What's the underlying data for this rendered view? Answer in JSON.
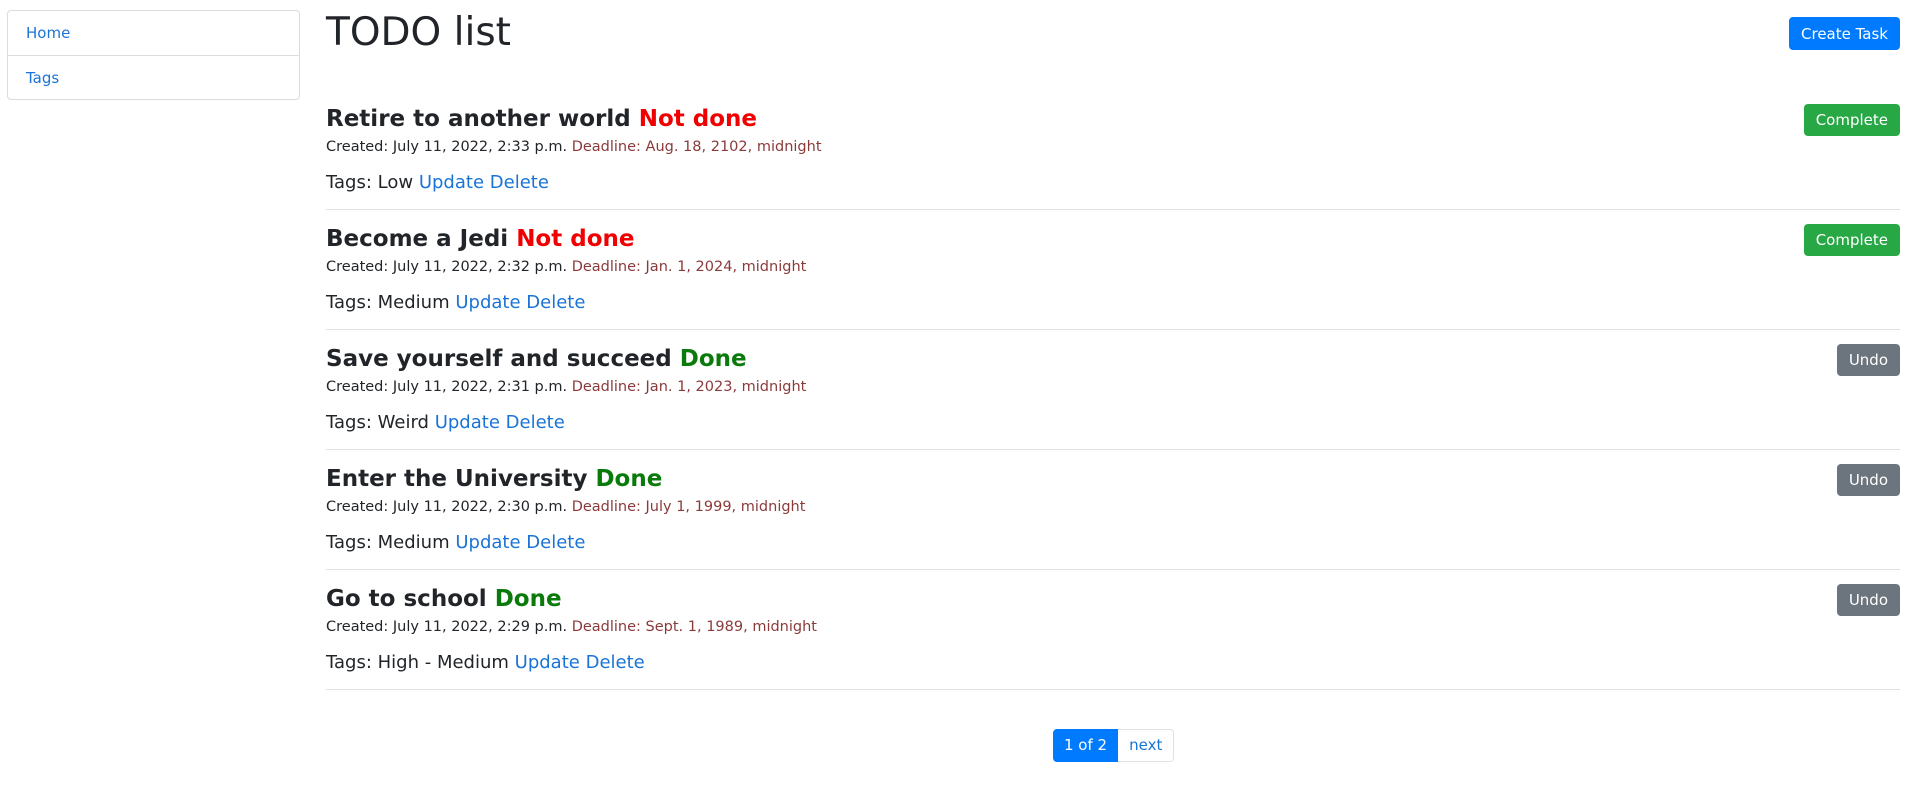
{
  "sidebar": {
    "items": [
      {
        "label": "Home"
      },
      {
        "label": "Tags"
      }
    ]
  },
  "header": {
    "title": "TODO list",
    "create_label": "Create Task"
  },
  "tasks": [
    {
      "title": "Retire to another world",
      "status": "Not done",
      "created": "Created: July 11, 2022, 2:33 p.m.",
      "deadline": "Deadline: Aug. 18, 2102, midnight",
      "tags": "Tags: Low",
      "update": "Update",
      "delete": "Delete",
      "action": "Complete"
    },
    {
      "title": "Become a Jedi",
      "status": "Not done",
      "created": "Created: July 11, 2022, 2:32 p.m.",
      "deadline": "Deadline: Jan. 1, 2024, midnight",
      "tags": "Tags: Medium",
      "update": "Update",
      "delete": "Delete",
      "action": "Complete"
    },
    {
      "title": "Save yourself and succeed",
      "status": "Done",
      "created": "Created: July 11, 2022, 2:31 p.m.",
      "deadline": "Deadline: Jan. 1, 2023, midnight",
      "tags": "Tags: Weird",
      "update": "Update",
      "delete": "Delete",
      "action": "Undo"
    },
    {
      "title": "Enter the University",
      "status": "Done",
      "created": "Created: July 11, 2022, 2:30 p.m.",
      "deadline": "Deadline: July 1, 1999, midnight",
      "tags": "Tags: Medium",
      "update": "Update",
      "delete": "Delete",
      "action": "Undo"
    },
    {
      "title": "Go to school",
      "status": "Done",
      "created": "Created: July 11, 2022, 2:29 p.m.",
      "deadline": "Deadline: Sept. 1, 1989, midnight",
      "tags": "Tags: High - Medium",
      "update": "Update",
      "delete": "Delete",
      "action": "Undo"
    }
  ],
  "pagination": {
    "current": "1 of 2",
    "next": "next"
  },
  "colors": {
    "primary": "#007bff",
    "success": "#28a745",
    "secondary": "#6c757d",
    "not_done": "#f00000",
    "done": "#0a7a0a",
    "deadline": "#8b3a3a",
    "link": "#1a73d6"
  }
}
